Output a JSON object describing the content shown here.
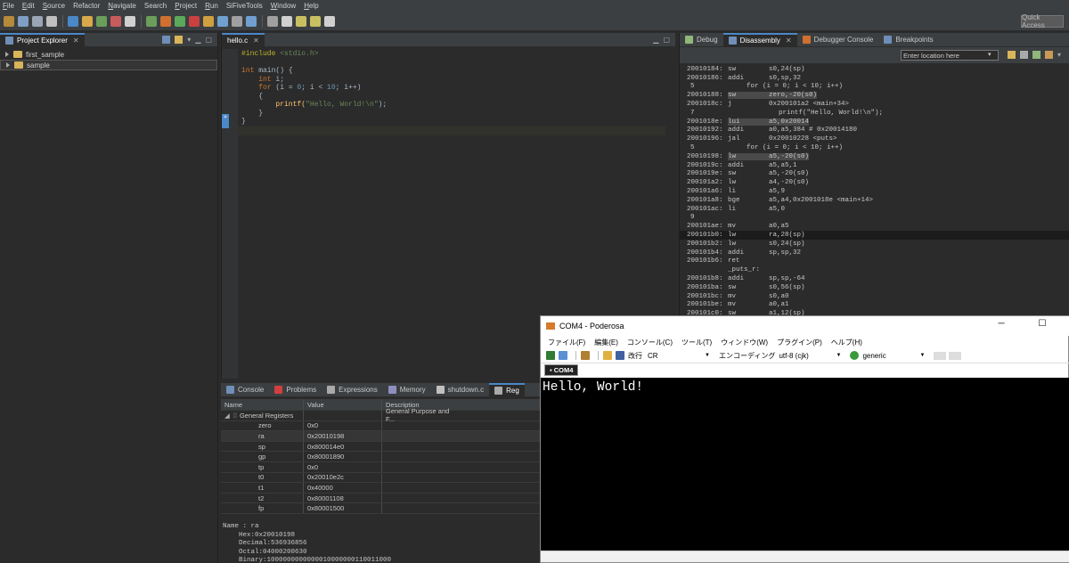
{
  "menubar": {
    "items": [
      "File",
      "Edit",
      "Source",
      "Refactor",
      "Navigate",
      "Search",
      "Project",
      "Run",
      "SiFiveTools",
      "Window",
      "Help"
    ],
    "underline_first": [
      true,
      true,
      true,
      false,
      true,
      false,
      true,
      true,
      false,
      true,
      true
    ]
  },
  "toolbar": {
    "quick_access": "Quick Access"
  },
  "project_explorer": {
    "tab_label": "Project Explorer",
    "items": [
      {
        "label": "first_sample"
      },
      {
        "label": "sample"
      }
    ]
  },
  "editor": {
    "tab_label": "hello.c",
    "lines": [
      {
        "t": "pp",
        "a": "#include ",
        "b": "<stdio.h>"
      },
      {
        "t": "blank"
      },
      {
        "t": "main",
        "a": "int",
        "b": " main() {"
      },
      {
        "t": "decl",
        "a": "    int",
        "b": " i;"
      },
      {
        "t": "for",
        "a": "    for",
        "b": " (i = ",
        "c": "0",
        "d": "; i < ",
        "e": "10",
        "f": "; i++)"
      },
      {
        "t": "plain",
        "a": "    {"
      },
      {
        "t": "call",
        "a": "        printf(",
        "b": "\"Hello, World!\\n\"",
        "c": ");"
      },
      {
        "t": "plain",
        "a": "    }"
      },
      {
        "t": "plain",
        "a": "}"
      }
    ]
  },
  "bottom_tabs": [
    "Console",
    "Problems",
    "Expressions",
    "Memory",
    "shutdown.c",
    "Reg"
  ],
  "registers": {
    "headers": [
      "Name",
      "Value",
      "Description"
    ],
    "group": {
      "name": "General Registers",
      "desc": "General Purpose and F..."
    },
    "rows": [
      {
        "name": "zero",
        "value": "0x0"
      },
      {
        "name": "ra",
        "value": "0x20010198"
      },
      {
        "name": "sp",
        "value": "0x800014e0"
      },
      {
        "name": "gp",
        "value": "0x80001890"
      },
      {
        "name": "tp",
        "value": "0x0"
      },
      {
        "name": "t0",
        "value": "0x20010e2c"
      },
      {
        "name": "t1",
        "value": "0x40000"
      },
      {
        "name": "t2",
        "value": "0x80001108"
      },
      {
        "name": "fp",
        "value": "0x80001500"
      }
    ],
    "detail": [
      "Name : ra",
      "    Hex:0x20010198",
      "    Decimal:536936856",
      "    Octal:04000200630",
      "    Binary:1000000000000010000000110011000"
    ]
  },
  "right_tabs": [
    "Debug",
    "Disassembly",
    "Debugger Console",
    "Breakpoints"
  ],
  "disassembly": {
    "location_placeholder": "Enter location here",
    "lines": [
      {
        "addr": "20010184:",
        "op": "sw",
        "args": "s0,24(sp)"
      },
      {
        "addr": "20010186:",
        "op": "addi",
        "args": "s0,sp,32"
      },
      {
        "src": "5             for (i = 0; i < 10; i++)"
      },
      {
        "addr": "20010188:",
        "op": "sw",
        "args": "zero,-20(s0)",
        "hl": true
      },
      {
        "addr": "2001018c:",
        "op": "j",
        "args": "0x200101a2 <main+34>"
      },
      {
        "src": "7                     printf(\"Hello, World!\\n\");"
      },
      {
        "addr": "2001018e:",
        "op": "lui",
        "args": "a5,0x20014",
        "hl": true
      },
      {
        "addr": "20010192:",
        "op": "addi",
        "args": "a0,a5,384 # 0x20014180"
      },
      {
        "addr": "20010196:",
        "op": "jal",
        "args": "0x20010228 <puts>"
      },
      {
        "src": "5             for (i = 0; i < 10; i++)"
      },
      {
        "addr": "20010198:",
        "op": "lw",
        "args": "a5,-20(s0)",
        "hl": true
      },
      {
        "addr": "2001019c:",
        "op": "addi",
        "args": "a5,a5,1"
      },
      {
        "addr": "2001019e:",
        "op": "sw",
        "args": "a5,-20(s0)"
      },
      {
        "addr": "200101a2:",
        "op": "lw",
        "args": "a4,-20(s0)"
      },
      {
        "addr": "200101a6:",
        "op": "li",
        "args": "a5,9"
      },
      {
        "addr": "200101a8:",
        "op": "bge",
        "args": "a5,a4,0x2001018e <main+14>"
      },
      {
        "addr": "200101ac:",
        "op": "li",
        "args": "a5,0"
      },
      {
        "src": "9"
      },
      {
        "addr": "200101ae:",
        "op": "mv",
        "args": "a0,a5"
      },
      {
        "addr": "200101b0:",
        "op": "lw",
        "args": "ra,28(sp)",
        "cur": true
      },
      {
        "addr": "200101b2:",
        "op": "lw",
        "args": "s0,24(sp)"
      },
      {
        "addr": "200101b4:",
        "op": "addi",
        "args": "sp,sp,32"
      },
      {
        "addr": "200101b6:",
        "op": "ret",
        "args": ""
      },
      {
        "label": "_puts_r:"
      },
      {
        "addr": "200101b8:",
        "op": "addi",
        "args": "sp,sp,-64"
      },
      {
        "addr": "200101ba:",
        "op": "sw",
        "args": "s0,56(sp)"
      },
      {
        "addr": "200101bc:",
        "op": "mv",
        "args": "s0,a0"
      },
      {
        "addr": "200101be:",
        "op": "mv",
        "args": "a0,a1"
      },
      {
        "addr": "200101c0:",
        "op": "sw",
        "args": "a1,12(sp)"
      }
    ]
  },
  "poderosa": {
    "title": "COM4 - Poderosa",
    "menu": [
      "ファイル(F)",
      "編集(E)",
      "コンソール(C)",
      "ツール(T)",
      "ウィンドウ(W)",
      "プラグイン(P)",
      "ヘルプ(H)"
    ],
    "newline_label": "改行",
    "newline_value": "CR",
    "encoding_label": "エンコーディング",
    "encoding_value": "utf-8 (cjk)",
    "terminal_type": "generic",
    "tab_label": "COM4",
    "terminal_output": "Hello, World!"
  }
}
